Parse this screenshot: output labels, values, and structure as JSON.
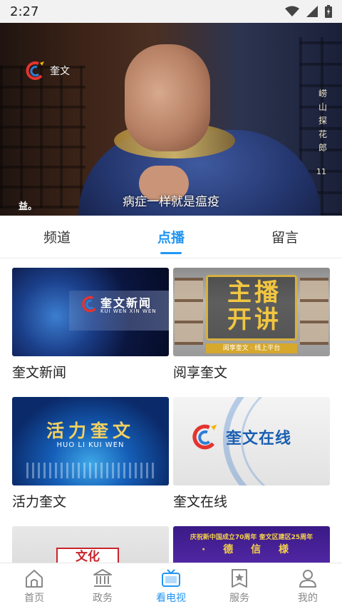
{
  "status_bar": {
    "time": "2:27"
  },
  "player": {
    "channel_logo_text": "奎文",
    "show_title_vertical": "崂山探花郎",
    "episode": "11",
    "subtitle": "病症一样就是瘟疫",
    "corner_mark": "益。"
  },
  "tabs": [
    {
      "label": "频道",
      "active": false
    },
    {
      "label": "点播",
      "active": true
    },
    {
      "label": "留言",
      "active": false
    }
  ],
  "programs": [
    {
      "label": "奎文新闻",
      "thumb_title": "奎文新闻",
      "thumb_subtitle": "KUI WEN XIN WEN"
    },
    {
      "label": "阅享奎文",
      "thumb_title": "主播开讲",
      "thumb_subtitle": "阅享奎文 · 线上平台"
    },
    {
      "label": "活力奎文",
      "thumb_title": "活力奎文",
      "thumb_subtitle": "HUO LI KUI WEN"
    },
    {
      "label": "奎文在线",
      "thumb_title": "奎文在线",
      "thumb_subtitle": ""
    },
    {
      "label": "",
      "thumb_title": "文化",
      "thumb_subtitle": ""
    },
    {
      "label": "",
      "thumb_title": "庆祝新中国成立70周年 奎文区建区25周年",
      "thumb_subtitle": "· 德 信 様"
    }
  ],
  "bottom_nav": [
    {
      "label": "首页",
      "icon": "home-icon",
      "active": false
    },
    {
      "label": "政务",
      "icon": "government-icon",
      "active": false
    },
    {
      "label": "看电视",
      "icon": "tv-icon",
      "active": true
    },
    {
      "label": "服务",
      "icon": "service-star-icon",
      "active": false
    },
    {
      "label": "我的",
      "icon": "profile-icon",
      "active": false
    }
  ],
  "colors": {
    "accent": "#2196f3",
    "inactive": "#888888"
  }
}
